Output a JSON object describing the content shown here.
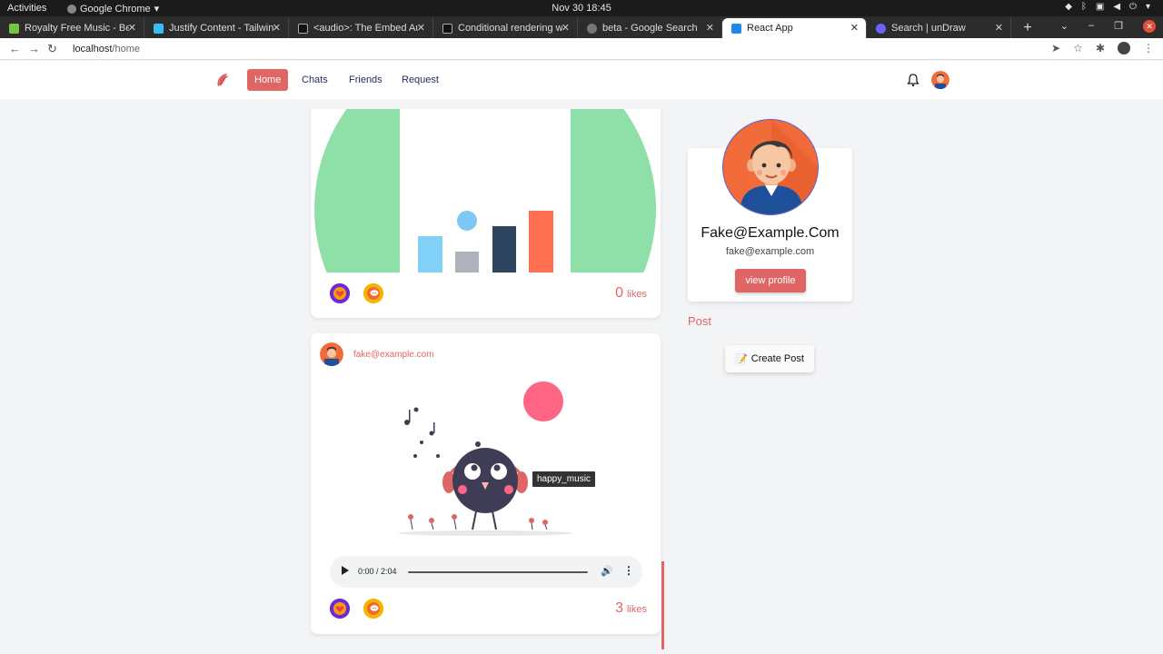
{
  "os": {
    "activities": "Activities",
    "app": "Google Chrome",
    "clock": "Nov 30  18:45"
  },
  "browser": {
    "tabs": [
      {
        "title": "Royalty Free Music - Bens",
        "color": "#7cc242"
      },
      {
        "title": "Justify Content - Tailwind",
        "color": "#38bdf8"
      },
      {
        "title": "<audio>: The Embed Audi",
        "color": "#111111"
      },
      {
        "title": "Conditional rendering wi",
        "color": "#111111"
      },
      {
        "title": "beta - Google Search",
        "color": "#777777"
      },
      {
        "title": "React App",
        "color": "#1e88e5"
      },
      {
        "title": "Search | unDraw",
        "color": "#6c63ff"
      }
    ],
    "url_host": "localhost",
    "url_path": "/home"
  },
  "nav": {
    "home": "Home",
    "chats": "Chats",
    "friends": "Friends",
    "request": "Request"
  },
  "posts": [
    {
      "likes_count": "0",
      "likes_label": "likes"
    },
    {
      "author": "fake@example.com",
      "tooltip": "happy_music",
      "audio_time": "0:00 / 2:04",
      "likes_count": "3",
      "likes_label": "likes"
    }
  ],
  "profile": {
    "name": "Fake@Example.Com",
    "email": "fake@example.com",
    "view_button": "view profile"
  },
  "post_section": {
    "label": "Post",
    "create_button": "Create Post",
    "create_icon": "📝"
  },
  "colors": {
    "accent": "#e06666",
    "react_heart": "#6d28d9",
    "react_chat": "#f5b400"
  }
}
